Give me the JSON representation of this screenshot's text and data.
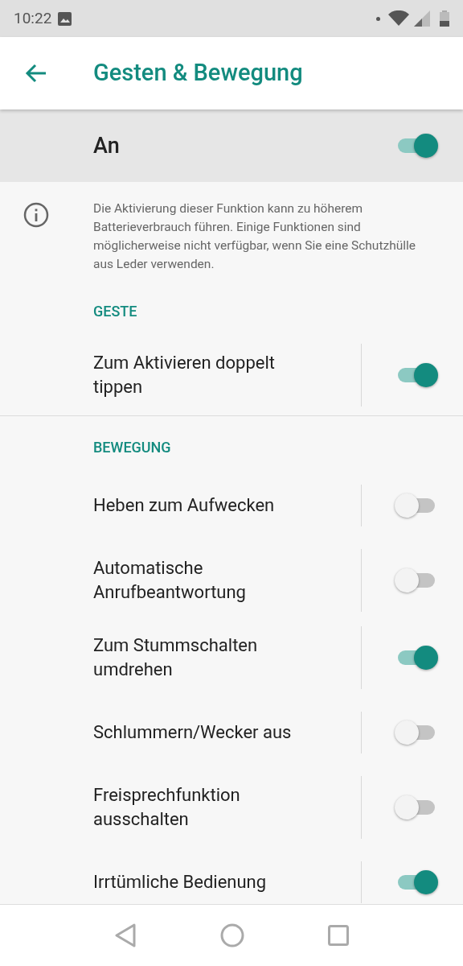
{
  "status_bar": {
    "time": "10:22"
  },
  "app_bar": {
    "title": "Gesten & Bewegung"
  },
  "master": {
    "label": "An",
    "on": true
  },
  "info": {
    "text": "Die Aktivierung dieser Funktion kann zu höherem Batterieverbrauch führen. Einige Funktionen sind möglicherweise nicht verfügbar, wenn Sie eine Schutzhülle aus Leder verwenden."
  },
  "sections": [
    {
      "header": "GESTE",
      "items": [
        {
          "label": "Zum Aktivieren doppelt tippen",
          "on": true
        }
      ]
    },
    {
      "header": "BEWEGUNG",
      "items": [
        {
          "label": "Heben zum Aufwecken",
          "on": false
        },
        {
          "label": "Automatische Anrufbeantwortung",
          "on": false
        },
        {
          "label": "Zum Stummschalten umdrehen",
          "on": true
        },
        {
          "label": "Schlummern/Wecker aus",
          "on": false
        },
        {
          "label": "Freisprechfunktion ausschalten",
          "on": false
        },
        {
          "label": "Irrtümliche Bedienung",
          "on": true
        }
      ]
    }
  ]
}
